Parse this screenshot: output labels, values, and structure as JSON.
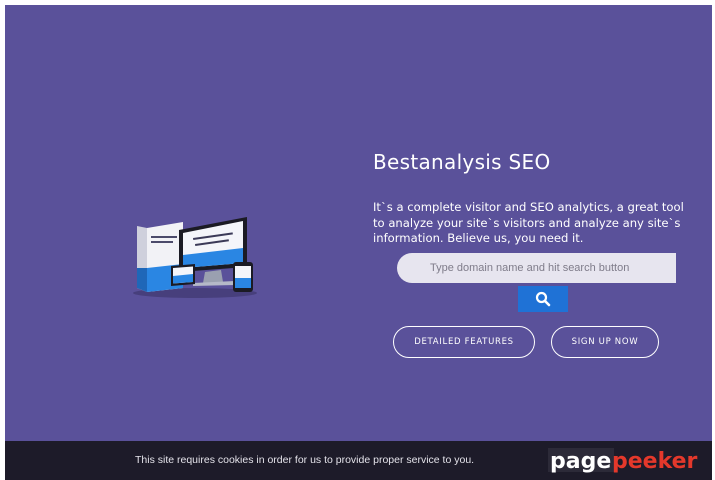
{
  "hero": {
    "title": "Bestanalysis SEO",
    "description": "It`s a complete visitor and SEO analytics, a great tool to analyze your site`s visitors and analyze any site`s information. Believe us, you need it.",
    "background": "#5a519a"
  },
  "search": {
    "placeholder": "Type domain name and hit search button",
    "button_icon": "search-icon",
    "button_color": "#1f72d6"
  },
  "actions": {
    "features_label": "DETAILED FEATURES",
    "signup_label": "SIGN UP NOW"
  },
  "cookie_notice": {
    "text": "This site requires cookies in order for us to provide proper service to you.",
    "background": "#1d1b29"
  },
  "watermark": {
    "part1": "page",
    "part2": "peeker",
    "color1": "#ffffff",
    "color2": "#e4382b"
  }
}
